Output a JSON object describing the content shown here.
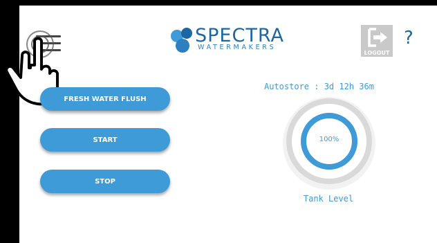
{
  "header": {
    "brand_name": "SPECTRA",
    "brand_tagline": "WATERMAKERS",
    "logout_label": "LOGOUT",
    "help_label": "?"
  },
  "actions": [
    {
      "label": "FRESH WATER FLUSH"
    },
    {
      "label": "START"
    },
    {
      "label": "STOP"
    }
  ],
  "status": {
    "autostore": "Autostore : 3d 12h 36m"
  },
  "tank": {
    "level_text": "100%",
    "level_fraction": 1.0,
    "label": "Tank Level"
  },
  "colors": {
    "accent": "#3e9bd7",
    "brand": "#1b66a3",
    "frame": "#000000"
  }
}
